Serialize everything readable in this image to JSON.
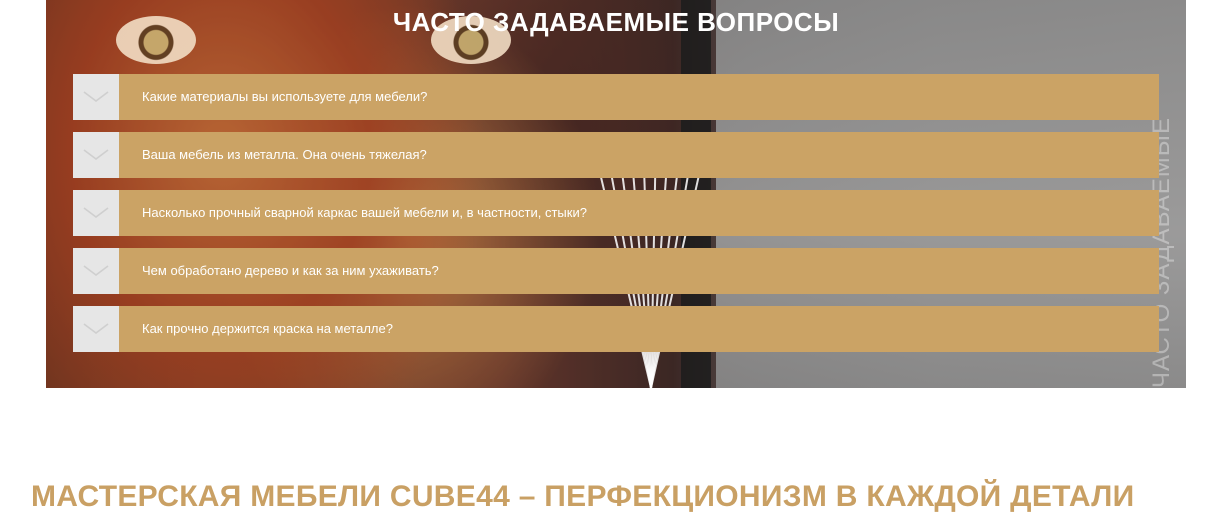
{
  "faq": {
    "title": "ЧАСТО ЗАДАВАЕМЫЕ ВОПРОСЫ",
    "watermark": "ЧАСТО ЗАДАВАЕМЫЕ",
    "items": [
      {
        "question": "Какие материалы вы используете для мебели?"
      },
      {
        "question": "Ваша мебель из металла. Она очень тяжелая?"
      },
      {
        "question": "Насколько прочный сварной каркас вашей мебели и, в частности, стыки?"
      },
      {
        "question": "Чем обработано дерево и как за ним ухаживать?"
      },
      {
        "question": "Как прочно держится краска на металле?"
      }
    ]
  },
  "bottom": {
    "heading": "МАСТЕРСКАЯ МЕБЕЛИ CUBE44 – ПЕРФЕКЦИОНИЗМ В КАЖДОЙ ДЕТАЛИ"
  },
  "colors": {
    "accent": "#cba365",
    "toggle_bg": "#e6e6e6",
    "heading_gold": "#c9a064"
  },
  "icons": {
    "toggle": "chevron-down-icon"
  }
}
